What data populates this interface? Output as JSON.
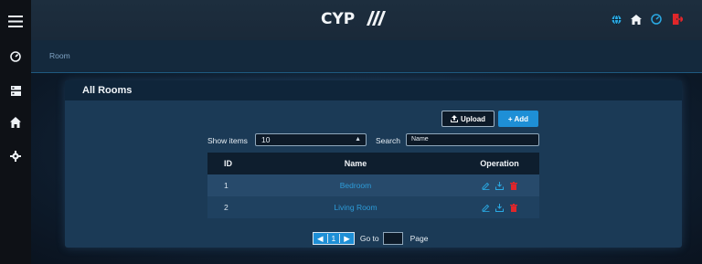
{
  "header": {
    "logo_text": "CYP",
    "icons": [
      "menu-icon",
      "globe-icon",
      "home-icon",
      "speedometer-icon",
      "logout-icon"
    ]
  },
  "sidebar": {
    "items": [
      {
        "icon": "dashboard-icon"
      },
      {
        "icon": "server-icon"
      },
      {
        "icon": "home-device-icon"
      },
      {
        "icon": "settings-icon"
      }
    ]
  },
  "breadcrumb": {
    "current": "Room"
  },
  "panel": {
    "title": "All Rooms",
    "upload_label": "Upload",
    "add_label": "+ Add",
    "show_items_label": "Show items",
    "show_items_value": "10",
    "search_label": "Search",
    "search_placeholder": "Name"
  },
  "table": {
    "columns": [
      "ID",
      "Name",
      "Operation"
    ],
    "rows": [
      {
        "id": "1",
        "name": "Bedroom"
      },
      {
        "id": "2",
        "name": "Living Room"
      }
    ]
  },
  "pager": {
    "current_page": "1",
    "goto_label": "Go to",
    "page_label": "Page"
  },
  "colors": {
    "accent": "#1e8fd6",
    "delete": "#e0262a",
    "logout": "#e0262a",
    "link": "#2d9bd8"
  }
}
